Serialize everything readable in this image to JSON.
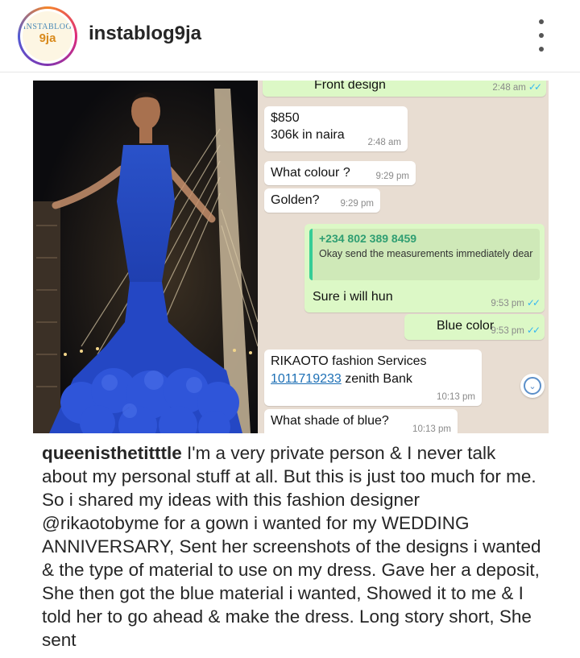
{
  "header": {
    "avatar_logo_top": "INSTABLOG",
    "avatar_logo_bottom": "9ja",
    "username": "instablog9ja",
    "more_icon": "vertical-ellipsis-icon"
  },
  "chat": {
    "messages": [
      {
        "text": "Front design",
        "time": "2:48 am",
        "direction": "out",
        "read": true
      },
      {
        "line1": "$850",
        "line2": "306k in naira",
        "time": "2:48 am",
        "direction": "in"
      },
      {
        "text": "What colour ?",
        "time": "9:29 pm",
        "direction": "in"
      },
      {
        "text": "Golden?",
        "time": "9:29 pm",
        "direction": "in"
      },
      {
        "quote_name": "+234 802 389 8459",
        "quote_text": "Okay send the measurements immediately dear",
        "text": "Sure i will hun",
        "time": "9:53 pm",
        "direction": "out",
        "read": true
      },
      {
        "text": "Blue color",
        "time": "9:53 pm",
        "direction": "out",
        "read": true
      },
      {
        "line1": "RIKAOTO fashion Services",
        "account": "1011719233",
        "bank": "zenith Bank",
        "time": "10:13 pm",
        "direction": "in"
      },
      {
        "text": "What shade of blue?",
        "time": "10:13 pm",
        "direction": "in"
      }
    ],
    "ticks": "✓✓",
    "scroll_icon": "chevron-down-circle-icon",
    "colors": {
      "wallpaper": "#e8ddd2",
      "outgoing": "#dcf8c6",
      "incoming": "#ffffff",
      "tick": "#34b7f1"
    }
  },
  "caption": {
    "username": "queenisthetitttle",
    "text_part1": " I'm a very private person & I never talk about my personal stuff at all. But this is just too much for me. So i shared my ideas with this fashion designer ",
    "mention": "@rikaotobyme",
    "text_part2": " for a gown i wanted for my WEDDING ANNIVERSARY, Sent her screenshots of the designs i wanted & the type of material to use on my dress. Gave her a deposit, She then got the blue material i wanted, Showed it to me & I told her to go ahead & make the dress. Long story short, She sent"
  }
}
